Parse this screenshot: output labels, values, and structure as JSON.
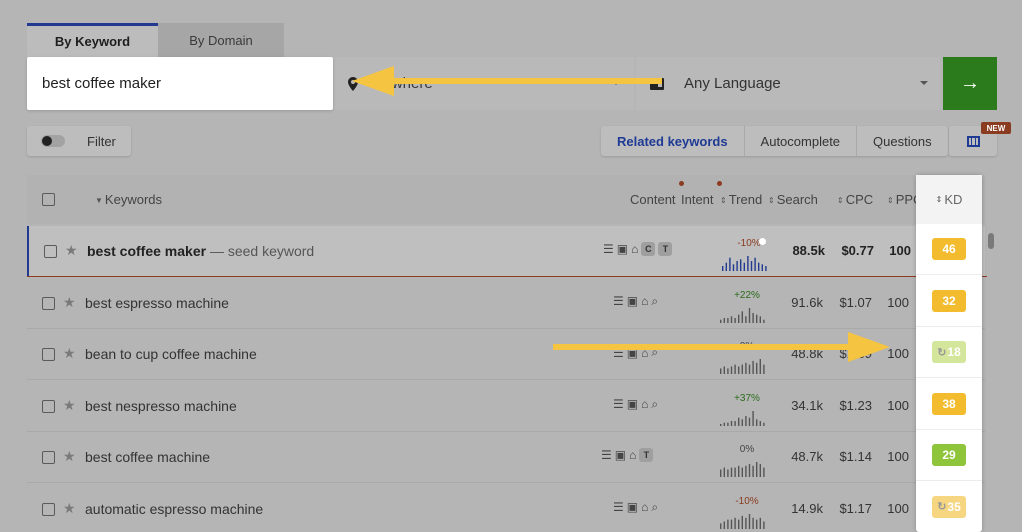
{
  "tabs": [
    {
      "label": "By Keyword",
      "active": true
    },
    {
      "label": "By Domain",
      "active": false
    }
  ],
  "search": {
    "value": "best coffee maker"
  },
  "location": {
    "label": "nywhere"
  },
  "language": {
    "label": "Any Language"
  },
  "toolbar": {
    "filter_label": "Filter",
    "keyword_tabs": [
      "Related keywords",
      "Autocomplete",
      "Questions"
    ],
    "new_badge": "NEW"
  },
  "table": {
    "headers": {
      "keywords": "Keywords",
      "content": "Content",
      "intent": "Intent",
      "trend": "Trend",
      "search": "Search",
      "cpc": "CPC",
      "ppc": "PPC",
      "kd": "KD"
    },
    "rows": [
      {
        "keyword": "best coffee maker",
        "seed_label": "— seed keyword",
        "trend": "-10%",
        "trend_sign": "neg",
        "search": "88.5k",
        "cpc": "$0.77",
        "ppc": "100",
        "kd": "46",
        "kd_color": "#f2bc2e",
        "spark": [
          3,
          5,
          8,
          4,
          6,
          7,
          5,
          9,
          6,
          8,
          5,
          4,
          3
        ],
        "intent": [
          "C",
          "T"
        ]
      },
      {
        "keyword": "best espresso machine",
        "trend": "+22%",
        "trend_sign": "pos",
        "search": "91.6k",
        "cpc": "$1.07",
        "ppc": "100",
        "kd": "32",
        "kd_color": "#f2bc2e",
        "spark": [
          2,
          3,
          3,
          4,
          3,
          5,
          7,
          4,
          9,
          6,
          5,
          4,
          2
        ],
        "intent": []
      },
      {
        "keyword": "bean to cup coffee machine",
        "trend": "0%",
        "trend_sign": "zero",
        "search": "48.8k",
        "cpc": "$1.39",
        "ppc": "100",
        "kd": "18",
        "kd_color": "#b9d65a",
        "kd_loading": true,
        "spark": [
          3,
          4,
          3,
          4,
          5,
          4,
          5,
          6,
          5,
          7,
          6,
          8,
          5
        ],
        "intent": []
      },
      {
        "keyword": "best nespresso machine",
        "trend": "+37%",
        "trend_sign": "pos",
        "search": "34.1k",
        "cpc": "$1.23",
        "ppc": "100",
        "kd": "38",
        "kd_color": "#f2bc2e",
        "spark": [
          1,
          2,
          2,
          3,
          3,
          5,
          4,
          6,
          5,
          9,
          4,
          3,
          2
        ],
        "intent": []
      },
      {
        "keyword": "best coffee machine",
        "trend": "0%",
        "trend_sign": "zero",
        "search": "48.7k",
        "cpc": "$1.14",
        "ppc": "100",
        "kd": "29",
        "kd_color": "#8fc53b",
        "spark": [
          4,
          5,
          4,
          5,
          5,
          6,
          5,
          6,
          7,
          6,
          8,
          7,
          5
        ],
        "intent": [
          "T"
        ]
      },
      {
        "keyword": "automatic espresso machine",
        "trend": "-10%",
        "trend_sign": "neg",
        "search": "14.9k",
        "cpc": "$1.17",
        "ppc": "100",
        "kd": "35",
        "kd_color": "#f2bc2e",
        "kd_loading": true,
        "spark": [
          3,
          4,
          5,
          5,
          6,
          5,
          7,
          6,
          8,
          6,
          5,
          6,
          4
        ],
        "intent": []
      }
    ]
  },
  "colors": {
    "accent": "#213a8f",
    "go_button": "#2b7a1b",
    "arrow": "#f5c542"
  }
}
